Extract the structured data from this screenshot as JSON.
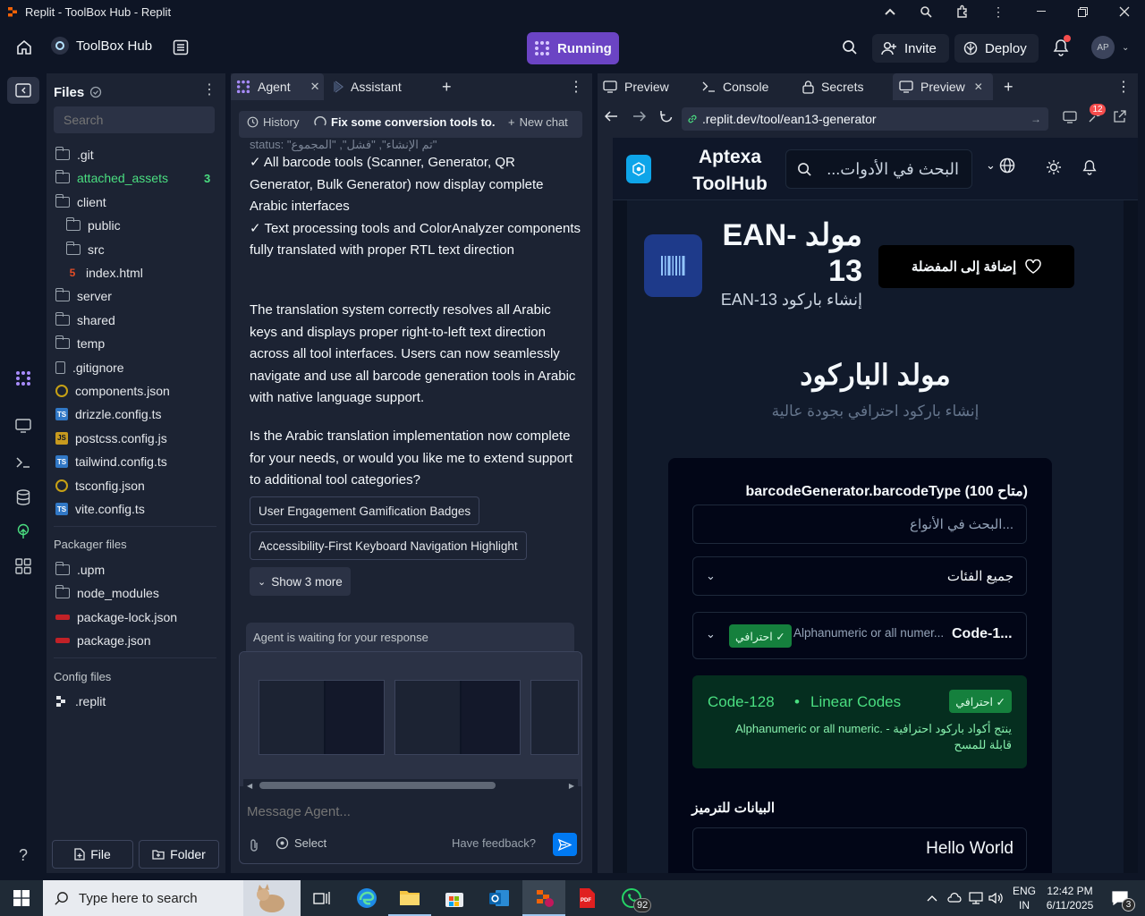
{
  "window": {
    "title": "Replit - ToolBox Hub - Replit"
  },
  "header": {
    "project_name": "ToolBox Hub",
    "run_status": "Running",
    "invite_label": "Invite",
    "deploy_label": "Deploy",
    "avatar_initials": "AP"
  },
  "files": {
    "title": "Files",
    "search_placeholder": "Search",
    "items": [
      {
        "name": ".git",
        "type": "folder"
      },
      {
        "name": "attached_assets",
        "type": "folder",
        "badge": "3"
      },
      {
        "name": "client",
        "type": "folder"
      },
      {
        "name": "public",
        "type": "folder"
      },
      {
        "name": "src",
        "type": "folder"
      },
      {
        "name": "index.html",
        "type": "html"
      },
      {
        "name": "server",
        "type": "folder"
      },
      {
        "name": "shared",
        "type": "folder"
      },
      {
        "name": "temp",
        "type": "folder"
      },
      {
        "name": ".gitignore",
        "type": "file"
      },
      {
        "name": "components.json",
        "type": "json"
      },
      {
        "name": "drizzle.config.ts",
        "type": "ts"
      },
      {
        "name": "postcss.config.js",
        "type": "js"
      },
      {
        "name": "tailwind.config.ts",
        "type": "ts"
      },
      {
        "name": "tsconfig.json",
        "type": "json"
      },
      {
        "name": "vite.config.ts",
        "type": "ts"
      }
    ],
    "packager_title": "Packager files",
    "packager_items": [
      {
        "name": ".upm",
        "type": "folder"
      },
      {
        "name": "node_modules",
        "type": "folder"
      },
      {
        "name": "package-lock.json",
        "type": "npm"
      },
      {
        "name": "package.json",
        "type": "npm"
      }
    ],
    "config_title": "Config files",
    "config_items": [
      {
        "name": ".replit",
        "type": "replit"
      }
    ],
    "new_file_label": "File",
    "new_folder_label": "Folder"
  },
  "agent": {
    "tab_agent": "Agent",
    "tab_assistant": "Assistant",
    "history_label": "History",
    "chat_title": "Fix some conversion tools to...",
    "new_chat_label": "New chat",
    "cutoff_text": "status: \"تم الإنشاء\", \"فشل\", \"المجموع\"",
    "paragraph1": "✓ All barcode tools (Scanner, Generator, QR Generator, Bulk Generator) now display complete Arabic interfaces\n✓ Text processing tools and ColorAnalyzer components fully translated with proper RTL text direction",
    "paragraph2": "The translation system correctly resolves all Arabic keys and displays proper right-to-left text direction across all tool interfaces. Users can now seamlessly navigate and use all barcode generation tools in Arabic with native language support.",
    "paragraph3": "Is the Arabic translation implementation now complete for your needs, or would you like me to extend support to additional tool categories?",
    "suggestions": [
      "User Engagement Gamification Badges",
      "Accessibility-First Keyboard Navigation Highlight"
    ],
    "show_more_label": "Show 3 more",
    "waiting_label": "Agent is waiting for your response",
    "input_placeholder": "Message Agent...",
    "select_label": "Select",
    "feedback_label": "Have feedback?"
  },
  "preview": {
    "tabs": [
      "Preview",
      "Console",
      "Secrets",
      "Preview"
    ],
    "url": ".replit.dev/tool/ean13-generator",
    "notif_count": "12",
    "site": {
      "brand_line1": "Aptexa",
      "brand_line2": "ToolHub",
      "search_placeholder": "البحث في الأدوات...",
      "tool_title_line1": "EAN- مولد",
      "tool_title_line2": "13",
      "tool_subtitle": "إنشاء باركود EAN-13",
      "favorite_label": "إضافة إلى المفضلة",
      "section_title": "مولد الباركود",
      "section_subtitle": "إنشاء باركود احترافي بجودة عالية",
      "barcode_type_label": "barcodeGenerator.barcodeType (100 متاح)",
      "type_search_placeholder": "البحث في الأنواع...",
      "category_select": "جميع الفئات",
      "type_select_code": "Code-1...",
      "type_select_desc": "Alphanumeric or all numer...",
      "pro_badge": "احترافي ✓",
      "info_code": "Code-128",
      "info_dot": "•",
      "info_category": "Linear Codes",
      "info_desc_line1": "Alphanumeric or all numeric. - ينتج أكواد باركود احترافية",
      "info_desc_line2": "قابلة للمسح",
      "data_label": "البيانات للترميز",
      "data_value": "Hello World"
    }
  },
  "taskbar": {
    "search_placeholder": "Type here to search",
    "whatsapp_badge": "92",
    "lang_top": "ENG",
    "lang_bottom": "IN",
    "time": "12:42 PM",
    "date": "6/11/2025",
    "notif_count": "3"
  },
  "colors": {
    "accent": "#6b44c4",
    "panel": "#1c2333",
    "bg": "#0e1525",
    "site_blue": "#0ea5e9",
    "green": "#22c55e"
  }
}
